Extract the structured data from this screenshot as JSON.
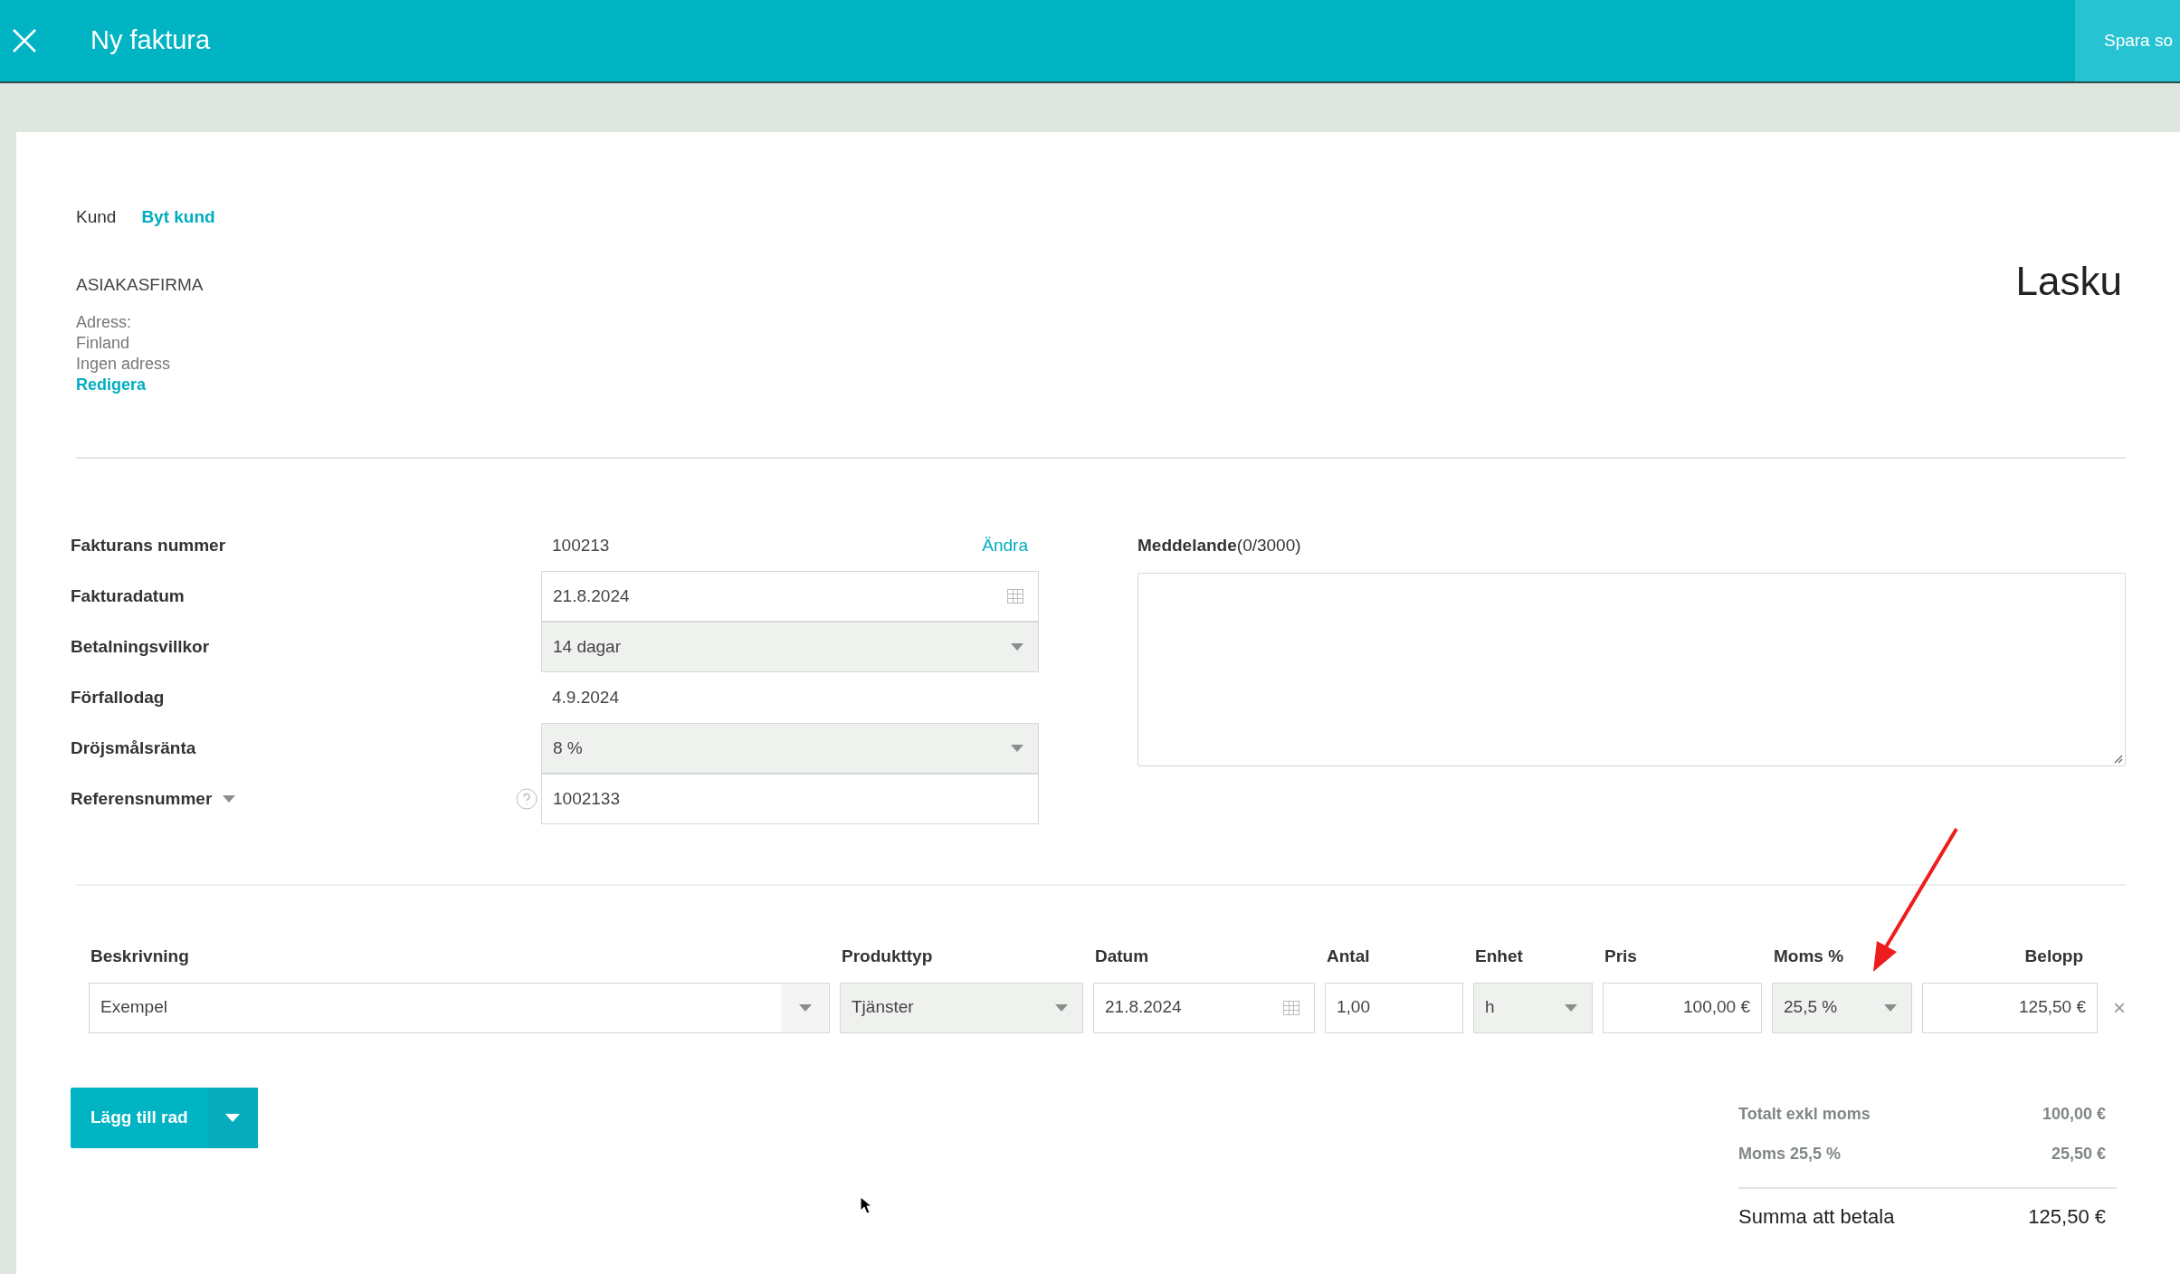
{
  "header": {
    "title": "Ny faktura",
    "save_button": "Spara so"
  },
  "customer": {
    "label": "Kund",
    "change_link": "Byt kund",
    "name": "ASIAKASFIRMA",
    "address_lines": [
      "Adress:",
      "Finland",
      "Ingen adress"
    ],
    "edit_link": "Redigera"
  },
  "document_title": "Lasku",
  "fields": [
    {
      "label": "Fakturans nummer",
      "kind": "text",
      "value": "100213",
      "action": "Ändra"
    },
    {
      "label": "Fakturadatum",
      "kind": "date",
      "value": "21.8.2024"
    },
    {
      "label": "Betalningsvillkor",
      "kind": "select",
      "value": "14 dagar"
    },
    {
      "label": "Förfallodag",
      "kind": "text",
      "value": "4.9.2024"
    },
    {
      "label": "Dröjsmålsränta",
      "kind": "select",
      "value": "8 %"
    },
    {
      "label": "Referensnummer",
      "kind": "input",
      "value": "1002133",
      "label_dropdown": true,
      "help": true
    }
  ],
  "message": {
    "label": "**Meddelande**(0/3000)"
  },
  "lines": {
    "columns": [
      "Beskrivning",
      "Produkttyp",
      "Datum",
      "Antal",
      "Enhet",
      "Pris",
      "Moms %",
      "Belopp"
    ],
    "rows": [
      {
        "cells": [
          {
            "kind": "combo",
            "value": "Exempel"
          },
          {
            "kind": "select",
            "value": "Tjänster"
          },
          {
            "kind": "date",
            "value": "21.8.2024"
          },
          {
            "kind": "input",
            "value": "1,00"
          },
          {
            "kind": "select",
            "value": "h"
          },
          {
            "kind": "number",
            "value": "100,00 €"
          },
          {
            "kind": "select",
            "value": "25,5 %"
          },
          {
            "kind": "number",
            "value": "125,50 €"
          }
        ],
        "remove": "×"
      }
    ]
  },
  "add_button": "Lägg till rad",
  "totals": [
    {
      "kind": "sub",
      "label": "Totalt exkl moms",
      "value": "100,00 €"
    },
    {
      "kind": "sub",
      "label": "Moms 25,5 %",
      "value": "25,50 €"
    },
    {
      "kind": "total",
      "label": "Summa att betala",
      "value": "125,50 €"
    }
  ]
}
